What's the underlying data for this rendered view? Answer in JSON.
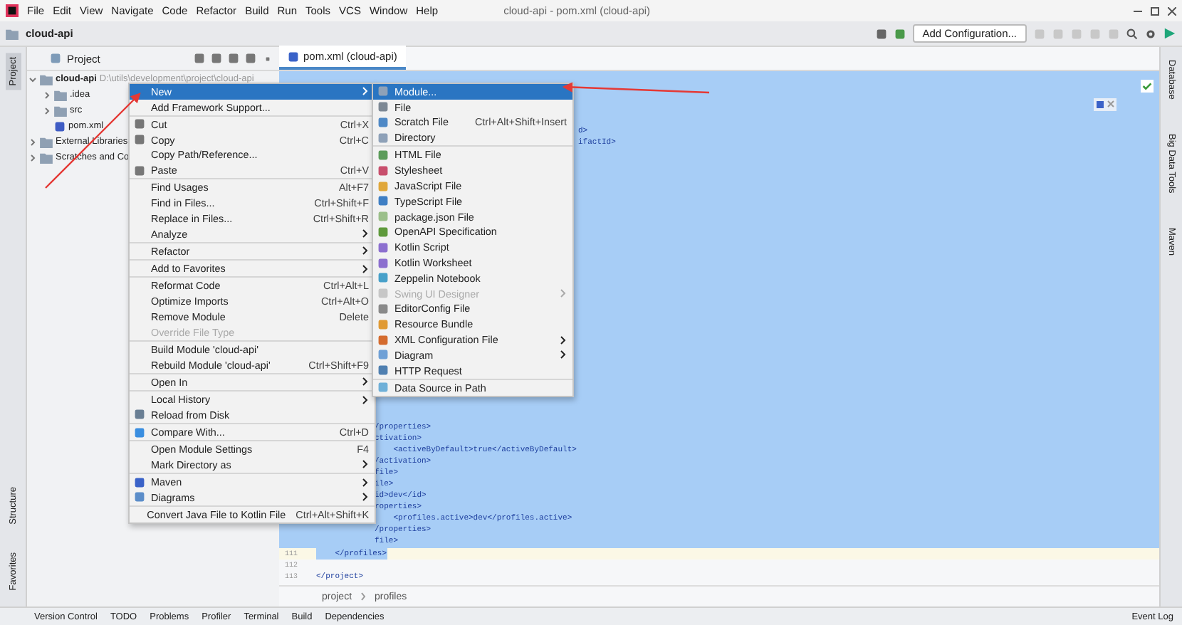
{
  "window": {
    "title": "cloud-api - pom.xml (cloud-api)"
  },
  "menu_bar": [
    "File",
    "Edit",
    "View",
    "Navigate",
    "Code",
    "Refactor",
    "Build",
    "Run",
    "Tools",
    "VCS",
    "Window",
    "Help"
  ],
  "navigation_bar": {
    "breadcrumb": "cloud-api",
    "add_configuration": "Add Configuration..."
  },
  "left_stripe": {
    "top": [
      {
        "label": "Project",
        "selected": true
      }
    ],
    "bottom": [
      {
        "label": "Structure",
        "selected": false
      },
      {
        "label": "Favorites",
        "selected": false
      }
    ]
  },
  "project_panel": {
    "title": "Project",
    "tree": [
      {
        "label": "cloud-api",
        "detail": "D:\\utils\\development\\project\\cloud-api",
        "expanded": true,
        "children": [
          {
            "label": ".idea",
            "expanded": false
          },
          {
            "label": "src",
            "expanded": false
          },
          {
            "label": "pom.xml"
          }
        ]
      },
      {
        "label": "External Libraries",
        "expanded": false
      },
      {
        "label": "Scratches and Co",
        "expanded": false
      }
    ]
  },
  "editor": {
    "tab": "pom.xml (cloud-api)",
    "top_lines": [
      "d>",
      "ifactId>"
    ],
    "selected_lines": [
      "/properties>",
      "ctivation>",
      "    <activeByDefault>true</activeByDefault>",
      "/activation>",
      "file>",
      "ile>",
      "id>dev</id>",
      "roperties>",
      "    <profiles.active>dev</profiles.active>",
      "/properties>",
      "file>"
    ],
    "lines": [
      {
        "number": "111",
        "text": "    </profiles>",
        "current": true
      },
      {
        "number": "112",
        "current": false
      },
      {
        "number": "113",
        "text": "</project>",
        "current": false
      }
    ],
    "breadcrumbs": [
      "project",
      "profiles"
    ]
  },
  "right_stripe": [
    "Database",
    "Big Data Tools",
    "Maven"
  ],
  "context_menu": [
    {
      "kind": "item",
      "label": "New",
      "submenu": true,
      "selected": true,
      "disabled": false
    },
    {
      "kind": "item",
      "label": "Add Framework Support...",
      "submenu": false,
      "selected": false,
      "disabled": false
    },
    {
      "kind": "separator"
    },
    {
      "kind": "item",
      "label": "Cut",
      "shortcut": "Ctrl+X",
      "submenu": false,
      "selected": false,
      "disabled": false
    },
    {
      "kind": "item",
      "label": "Copy",
      "shortcut": "Ctrl+C",
      "submenu": false,
      "selected": false,
      "disabled": false
    },
    {
      "kind": "item",
      "label": "Copy Path/Reference...",
      "submenu": false,
      "selected": false,
      "disabled": false
    },
    {
      "kind": "item",
      "label": "Paste",
      "shortcut": "Ctrl+V",
      "submenu": false,
      "selected": false,
      "disabled": false
    },
    {
      "kind": "separator"
    },
    {
      "kind": "item",
      "label": "Find Usages",
      "shortcut": "Alt+F7",
      "submenu": false,
      "selected": false,
      "disabled": false
    },
    {
      "kind": "item",
      "label": "Find in Files...",
      "shortcut": "Ctrl+Shift+F",
      "submenu": false,
      "selected": false,
      "disabled": false
    },
    {
      "kind": "item",
      "label": "Replace in Files...",
      "shortcut": "Ctrl+Shift+R",
      "submenu": false,
      "selected": false,
      "disabled": false
    },
    {
      "kind": "item",
      "label": "Analyze",
      "submenu": true,
      "selected": false,
      "disabled": false
    },
    {
      "kind": "separator"
    },
    {
      "kind": "item",
      "label": "Refactor",
      "submenu": true,
      "selected": false,
      "disabled": false
    },
    {
      "kind": "separator"
    },
    {
      "kind": "item",
      "label": "Add to Favorites",
      "submenu": true,
      "selected": false,
      "disabled": false
    },
    {
      "kind": "separator"
    },
    {
      "kind": "item",
      "label": "Reformat Code",
      "shortcut": "Ctrl+Alt+L",
      "submenu": false,
      "selected": false,
      "disabled": false
    },
    {
      "kind": "item",
      "label": "Optimize Imports",
      "shortcut": "Ctrl+Alt+O",
      "submenu": false,
      "selected": false,
      "disabled": false
    },
    {
      "kind": "item",
      "label": "Remove Module",
      "shortcut": "Delete",
      "submenu": false,
      "selected": false,
      "disabled": false
    },
    {
      "kind": "item",
      "label": "Override File Type",
      "submenu": false,
      "selected": false,
      "disabled": true
    },
    {
      "kind": "separator"
    },
    {
      "kind": "item",
      "label": "Build Module 'cloud-api'",
      "submenu": false,
      "selected": false,
      "disabled": false
    },
    {
      "kind": "item",
      "label": "Rebuild Module 'cloud-api'",
      "shortcut": "Ctrl+Shift+F9",
      "submenu": false,
      "selected": false,
      "disabled": false
    },
    {
      "kind": "separator"
    },
    {
      "kind": "item",
      "label": "Open In",
      "submenu": true,
      "selected": false,
      "disabled": false
    },
    {
      "kind": "separator"
    },
    {
      "kind": "item",
      "label": "Local History",
      "submenu": true,
      "selected": false,
      "disabled": false
    },
    {
      "kind": "item",
      "label": "Reload from Disk",
      "submenu": false,
      "selected": false,
      "disabled": false
    },
    {
      "kind": "separator"
    },
    {
      "kind": "item",
      "label": "Compare With...",
      "shortcut": "Ctrl+D",
      "submenu": false,
      "selected": false,
      "disabled": false
    },
    {
      "kind": "separator"
    },
    {
      "kind": "item",
      "label": "Open Module Settings",
      "shortcut": "F4",
      "submenu": false,
      "selected": false,
      "disabled": false
    },
    {
      "kind": "item",
      "label": "Mark Directory as",
      "submenu": true,
      "selected": false,
      "disabled": false
    },
    {
      "kind": "separator"
    },
    {
      "kind": "item",
      "label": "Maven",
      "submenu": true,
      "selected": false,
      "disabled": false
    },
    {
      "kind": "item",
      "label": "Diagrams",
      "submenu": true,
      "selected": false,
      "disabled": false
    },
    {
      "kind": "separator"
    },
    {
      "kind": "item",
      "label": "Convert Java File to Kotlin File",
      "shortcut": "Ctrl+Alt+Shift+K",
      "submenu": false,
      "selected": false,
      "disabled": false
    }
  ],
  "new_submenu": [
    {
      "kind": "item",
      "label": "Module...",
      "submenu": false,
      "selected": true,
      "disabled": false
    },
    {
      "kind": "item",
      "label": "File",
      "submenu": false,
      "selected": false,
      "disabled": false
    },
    {
      "kind": "item",
      "label": "Scratch File",
      "shortcut": "Ctrl+Alt+Shift+Insert",
      "submenu": false,
      "selected": false,
      "disabled": false
    },
    {
      "kind": "item",
      "label": "Directory",
      "submenu": false,
      "selected": false,
      "disabled": false
    },
    {
      "kind": "separator"
    },
    {
      "kind": "item",
      "label": "HTML File",
      "submenu": false,
      "selected": false,
      "disabled": false
    },
    {
      "kind": "item",
      "label": "Stylesheet",
      "submenu": false,
      "selected": false,
      "disabled": false
    },
    {
      "kind": "item",
      "label": "JavaScript File",
      "submenu": false,
      "selected": false,
      "disabled": false
    },
    {
      "kind": "item",
      "label": "TypeScript File",
      "submenu": false,
      "selected": false,
      "disabled": false
    },
    {
      "kind": "item",
      "label": "package.json File",
      "submenu": false,
      "selected": false,
      "disabled": false
    },
    {
      "kind": "item",
      "label": "OpenAPI Specification",
      "submenu": false,
      "selected": false,
      "disabled": false
    },
    {
      "kind": "item",
      "label": "Kotlin Script",
      "submenu": false,
      "selected": false,
      "disabled": false
    },
    {
      "kind": "item",
      "label": "Kotlin Worksheet",
      "submenu": false,
      "selected": false,
      "disabled": false
    },
    {
      "kind": "item",
      "label": "Zeppelin Notebook",
      "submenu": false,
      "selected": false,
      "disabled": false
    },
    {
      "kind": "item",
      "label": "Swing UI Designer",
      "submenu": true,
      "selected": false,
      "disabled": true
    },
    {
      "kind": "item",
      "label": "EditorConfig File",
      "submenu": false,
      "selected": false,
      "disabled": false
    },
    {
      "kind": "item",
      "label": "Resource Bundle",
      "submenu": false,
      "selected": false,
      "disabled": false
    },
    {
      "kind": "item",
      "label": "XML Configuration File",
      "submenu": true,
      "selected": false,
      "disabled": false
    },
    {
      "kind": "item",
      "label": "Diagram",
      "submenu": true,
      "selected": false,
      "disabled": false
    },
    {
      "kind": "item",
      "label": "HTTP Request",
      "submenu": false,
      "selected": false,
      "disabled": false
    },
    {
      "kind": "separator"
    },
    {
      "kind": "item",
      "label": "Data Source in Path",
      "submenu": false,
      "selected": false,
      "disabled": false
    }
  ],
  "bottom_bar": {
    "tools": [
      "Version Control",
      "TODO",
      "Problems",
      "Profiler",
      "Terminal",
      "Build",
      "Dependencies"
    ],
    "event_log": "Event Log"
  }
}
